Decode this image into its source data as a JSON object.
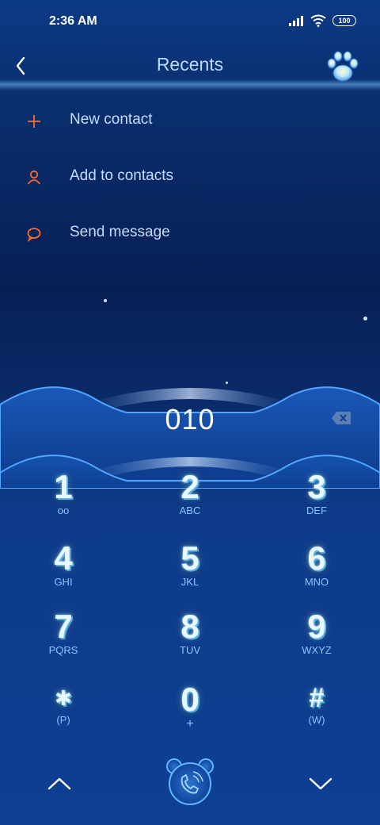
{
  "status": {
    "time": "2:36 AM",
    "battery": "100"
  },
  "header": {
    "title": "Recents"
  },
  "menu": [
    {
      "label": "New contact",
      "icon": "plus-icon"
    },
    {
      "label": "Add to contacts",
      "icon": "person-icon"
    },
    {
      "label": "Send message",
      "icon": "message-bubble-icon"
    }
  ],
  "dialer": {
    "number": "010"
  },
  "keys": [
    {
      "digit": "1",
      "sub": "oo"
    },
    {
      "digit": "2",
      "sub": "ABC"
    },
    {
      "digit": "3",
      "sub": "DEF"
    },
    {
      "digit": "4",
      "sub": "GHI"
    },
    {
      "digit": "5",
      "sub": "JKL"
    },
    {
      "digit": "6",
      "sub": "MNO"
    },
    {
      "digit": "7",
      "sub": "PQRS"
    },
    {
      "digit": "8",
      "sub": "TUV"
    },
    {
      "digit": "9",
      "sub": "WXYZ"
    },
    {
      "digit": "✱",
      "sub": "(P)"
    },
    {
      "digit": "0",
      "sub": "+"
    },
    {
      "digit": "#",
      "sub": "(W)"
    }
  ],
  "colors": {
    "accent": "#ff6a2a",
    "text": "#c6dcff",
    "background": "#0a2f6e"
  }
}
